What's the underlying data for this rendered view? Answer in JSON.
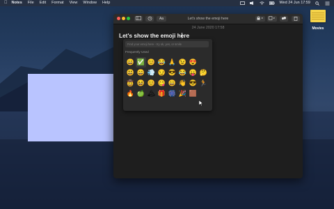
{
  "menubar": {
    "app": "Notes",
    "items": [
      "File",
      "Edit",
      "Format",
      "View",
      "Window",
      "Help"
    ],
    "clock": "Wed 24 Jun  17:59"
  },
  "desktop": {
    "icon_label": "Movies"
  },
  "window": {
    "title": "Let's show the emoji here",
    "date": "24 June 2020 17:58",
    "note_title": "Let's show the emoji here",
    "toolbar": {
      "format_label": "Aa"
    }
  },
  "emoji_picker": {
    "search_placeholder": "Find your emoji here - try ok, yes, or smile",
    "section": "Frequently Used",
    "emojis": [
      "😀",
      "✅",
      "😊",
      "😂",
      "🙏",
      "😉",
      "😍",
      "",
      "😃",
      "😄",
      "💨",
      "😏",
      "😎",
      "😂",
      "😛",
      "🤔",
      "🤠",
      "😆",
      "😊",
      "😋",
      "😄",
      "👋",
      "😎",
      "🏃",
      "🔥",
      "🍏",
      "🏔",
      "🎁",
      "🎆",
      "🎉",
      "🟫",
      ""
    ]
  }
}
